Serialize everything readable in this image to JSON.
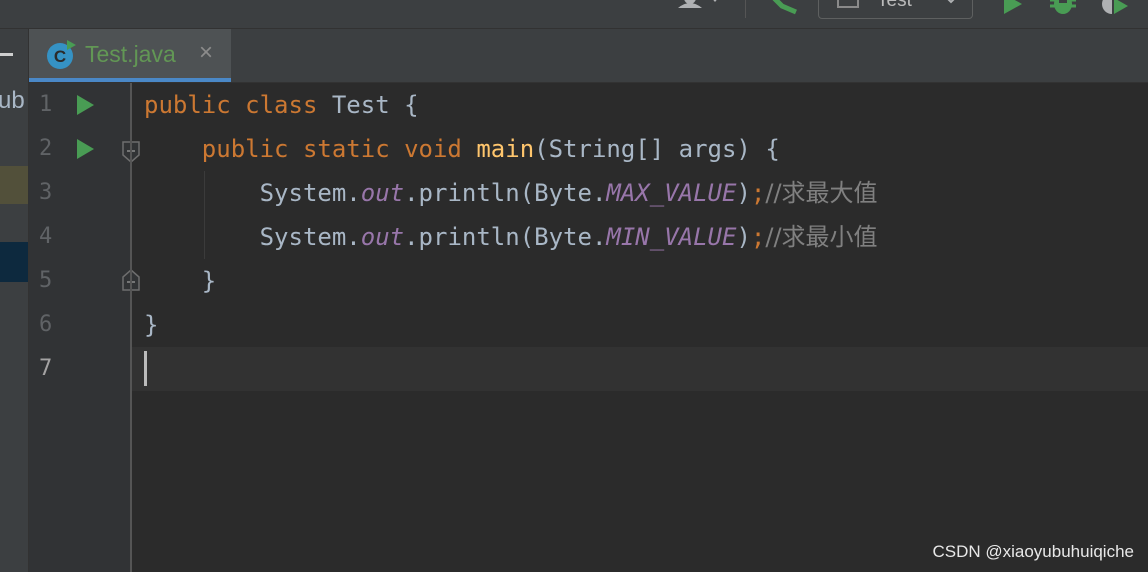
{
  "toolbar": {
    "run_config_label": "Test"
  },
  "left_strip": {
    "text": "ub"
  },
  "tab": {
    "label": "Test.java",
    "close_symbol": "×",
    "icon_letter": "C"
  },
  "gutter": {
    "line_numbers": [
      "1",
      "2",
      "3",
      "4",
      "5",
      "6",
      "7"
    ]
  },
  "code": {
    "line1": {
      "kw": "public class",
      "name": " Test ",
      "brace": "{"
    },
    "line2": {
      "indent": "    ",
      "kw": "public static void",
      "fn": "main",
      "rest": "(String[] args) {"
    },
    "line3": {
      "indent": "        ",
      "sys": "System.",
      "field": "out",
      "call": ".println(Byte.",
      "const": "MAX_VALUE",
      "close": ")",
      "semi": ";",
      "comment": "//求最大值"
    },
    "line4": {
      "indent": "        ",
      "sys": "System.",
      "field": "out",
      "call": ".println(Byte.",
      "const": "MIN_VALUE",
      "close": ")",
      "semi": ";",
      "comment": "//求最小值"
    },
    "line5": {
      "indent": "    ",
      "brace": "}"
    },
    "line6": {
      "brace": "}"
    }
  },
  "watermark": "CSDN @xiaoyubuhuiqiche",
  "colors": {
    "background": "#2b2b2b",
    "keyword": "#cc7832",
    "function": "#ffc66d",
    "field": "#9876aa",
    "comment": "#808080",
    "tab_underline": "#4a88c7",
    "run_green": "#499c54"
  }
}
